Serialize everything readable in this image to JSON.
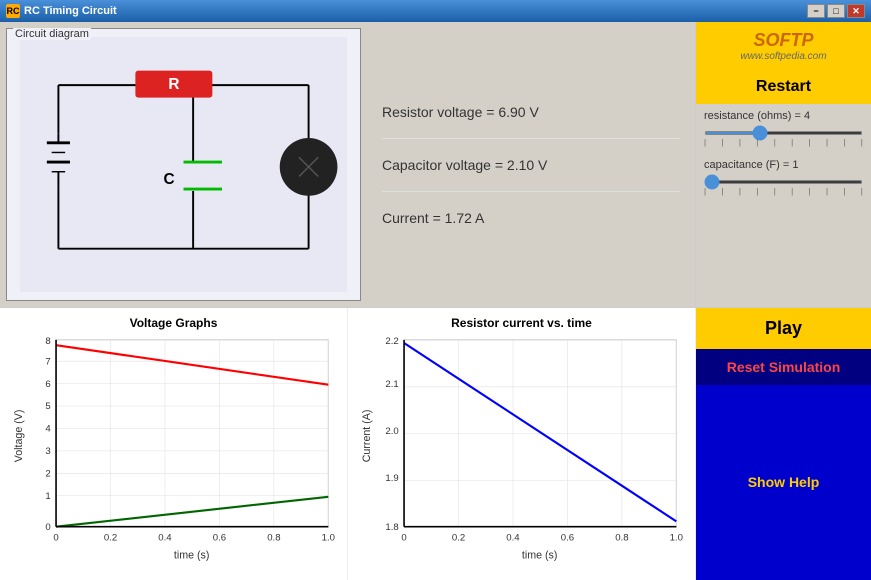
{
  "titlebar": {
    "icon": "RC",
    "title": "RC Timing Circuit",
    "min_label": "−",
    "max_label": "□",
    "close_label": "✕"
  },
  "circuit": {
    "panel_label": "Circuit diagram"
  },
  "readings": {
    "resistor_voltage": "Resistor voltage = 6.90 V",
    "capacitor_voltage": "Capacitor voltage = 2.10 V",
    "current": "Current = 1.72 A"
  },
  "controls": {
    "watermark_title": "SOFTP",
    "watermark_sub": "www.softpedia.com",
    "restart_label": "Restart",
    "resistance_label": "resistance (ohms) = 4",
    "resistance_value": 4,
    "resistance_min": 1,
    "resistance_max": 10,
    "capacitance_label": "capacitance (F) = 1",
    "capacitance_value": 1,
    "capacitance_min": 1,
    "capacitance_max": 10,
    "play_label": "Play",
    "reset_label": "Reset Simulation",
    "help_label": "Show Help"
  },
  "voltage_graph": {
    "title": "Voltage Graphs",
    "x_label": "time (s)",
    "y_label": "Voltage (V)",
    "x_ticks": [
      "0",
      "0.2",
      "0.4",
      "0.6",
      "0.8",
      "1.0"
    ],
    "y_ticks": [
      "0",
      "1",
      "2",
      "3",
      "4",
      "5",
      "6",
      "7",
      "8"
    ]
  },
  "current_graph": {
    "title": "Resistor current vs. time",
    "x_label": "time (s)",
    "y_label": "Current (A)",
    "x_ticks": [
      "0",
      "0.2",
      "0.4",
      "0.6",
      "0.8",
      "1.0"
    ],
    "y_ticks": [
      "1.8",
      "1.9",
      "2.0",
      "2.1",
      "2.2"
    ]
  }
}
